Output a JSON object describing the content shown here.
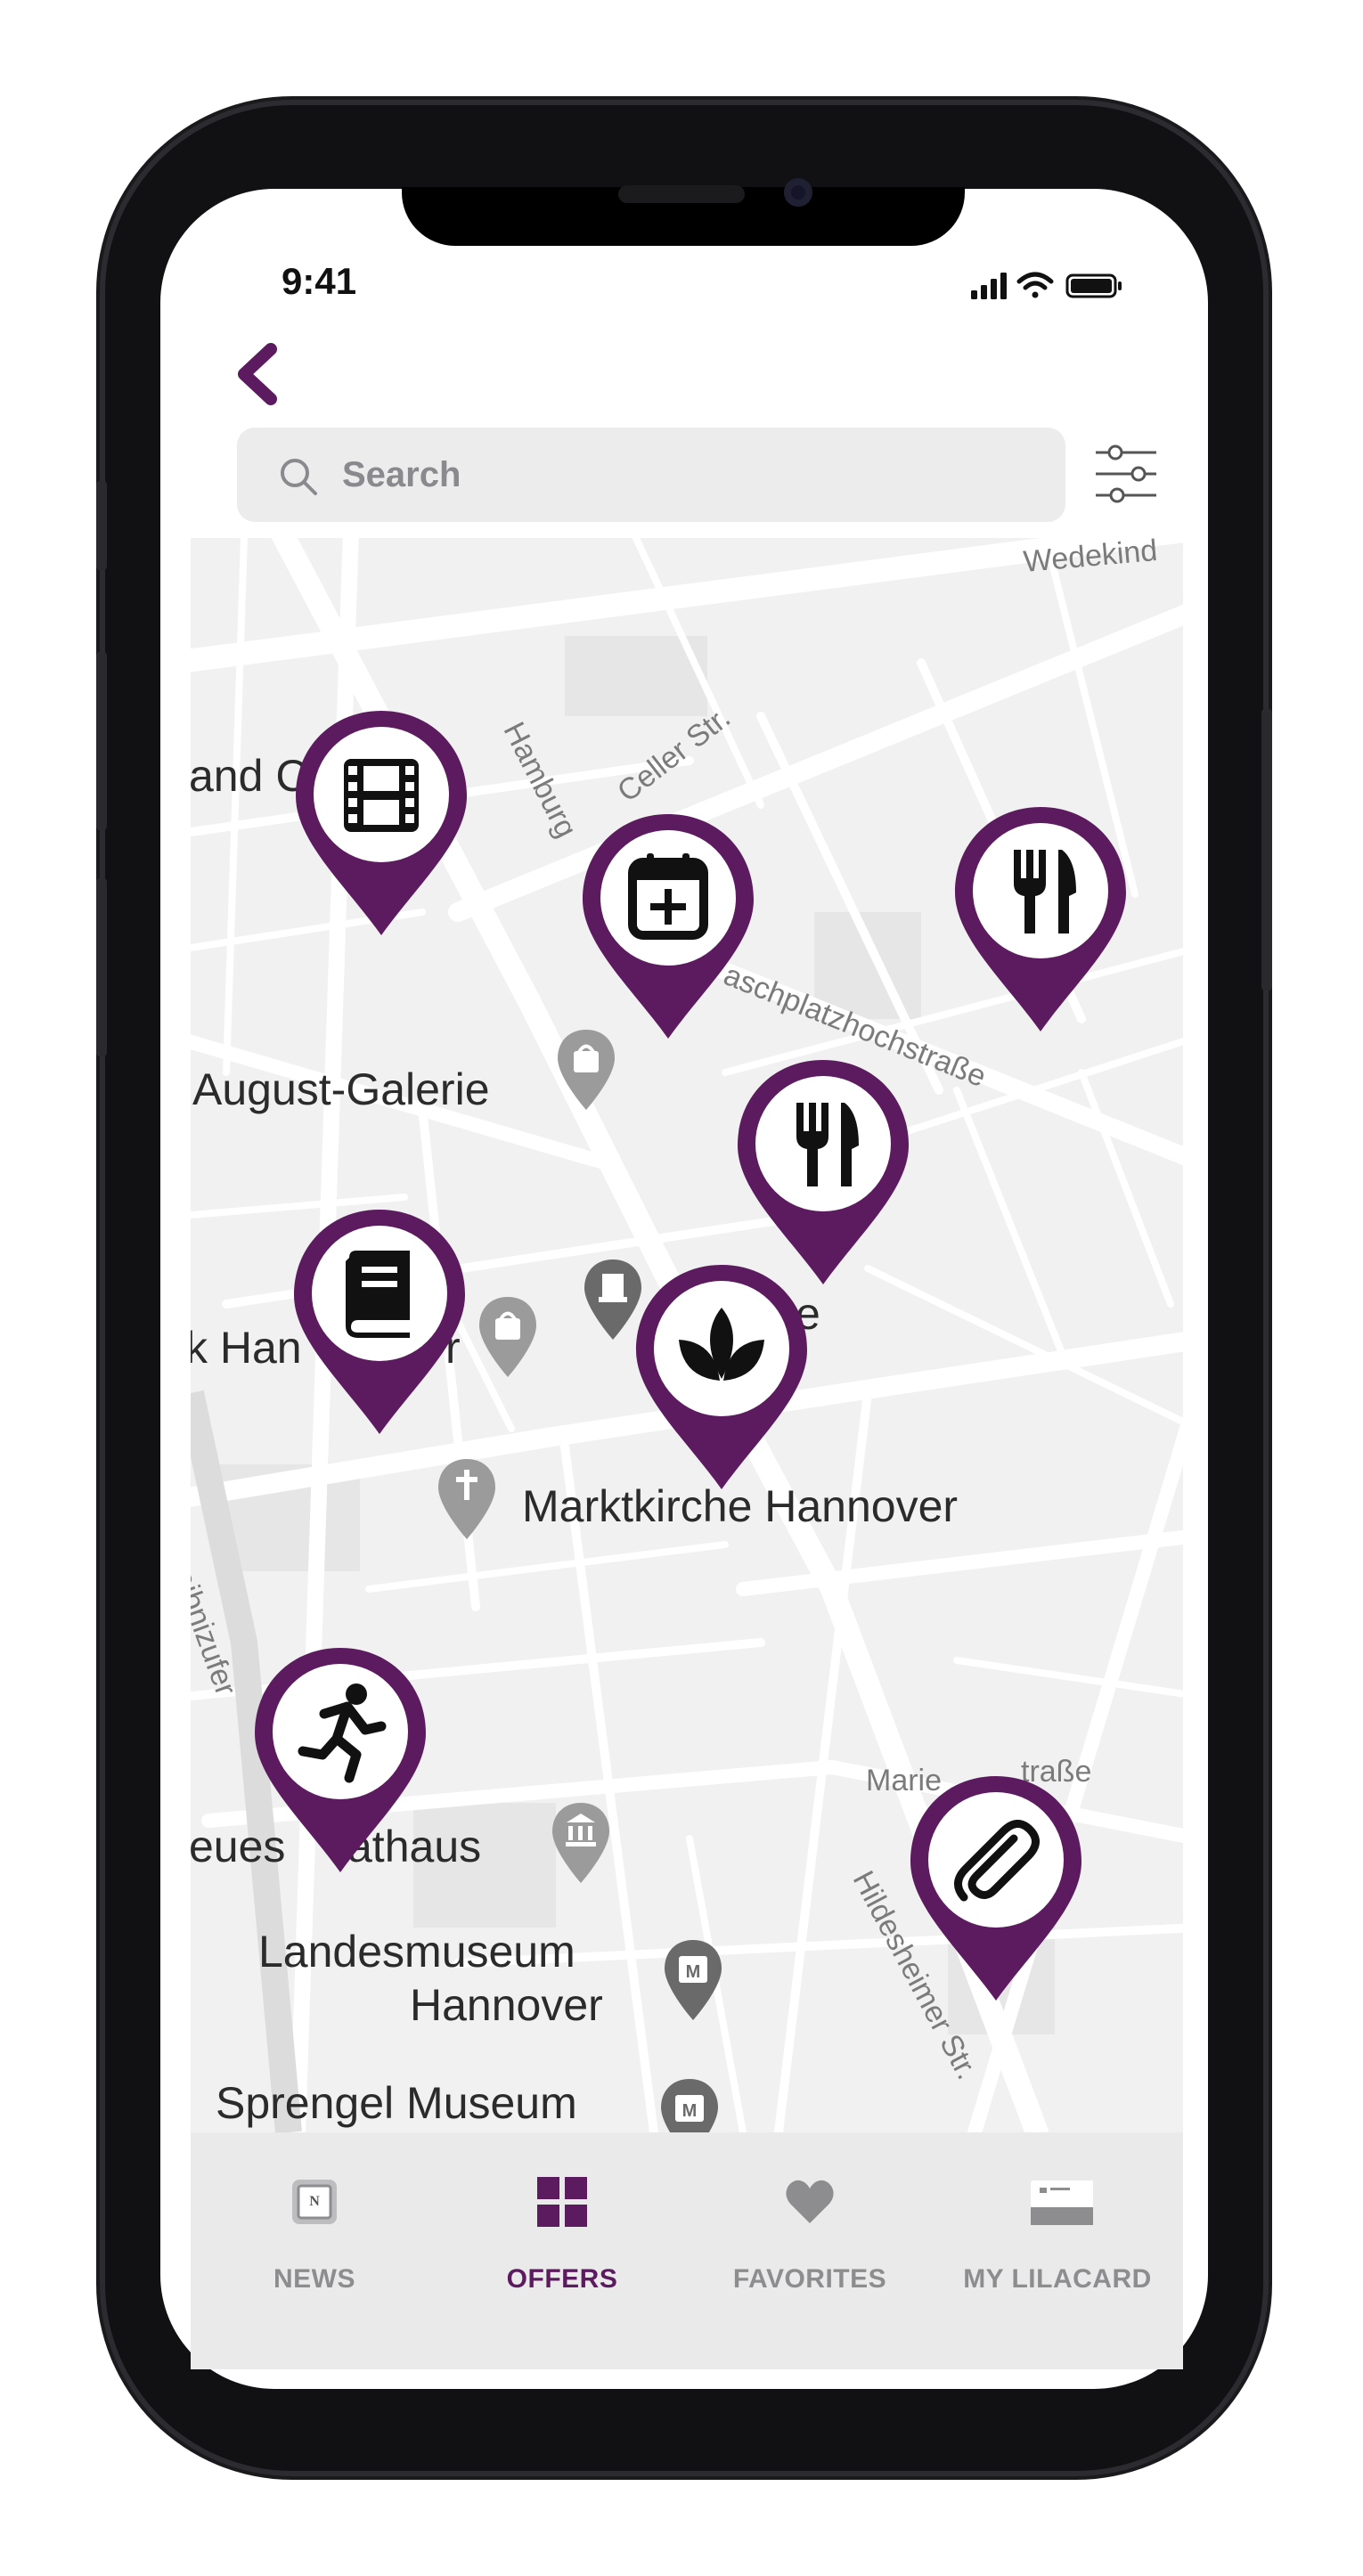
{
  "status_bar": {
    "time": "9:41"
  },
  "search": {
    "placeholder": "Search",
    "value": ""
  },
  "colors": {
    "accent": "#5c1b5f",
    "tab_inactive": "#8d8d90",
    "map_bg": "#f1f1f1"
  },
  "map": {
    "places": [
      "and C",
      "August-Galerie",
      "k Han",
      "r",
      "ke",
      "Marktkirche Hannover",
      "eues",
      "athaus",
      "Landesmuseum",
      "Hannover",
      "Sprengel Museum"
    ],
    "streets": [
      "Wedekind",
      "Hamburg",
      "Celler Str.",
      "aschplatzhochstraße",
      "eibnizufer",
      "Marie",
      "traße",
      "Hildesheimer Str."
    ],
    "pins": [
      {
        "icon": "film-icon"
      },
      {
        "icon": "calendar-add-icon"
      },
      {
        "icon": "fork-knife-icon"
      },
      {
        "icon": "fork-knife-icon"
      },
      {
        "icon": "book-icon"
      },
      {
        "icon": "lotus-icon"
      },
      {
        "icon": "running-person-icon"
      },
      {
        "icon": "paperclip-icon"
      }
    ]
  },
  "tabs": [
    {
      "label": "NEWS",
      "icon": "news-icon",
      "active": false
    },
    {
      "label": "OFFERS",
      "icon": "grid-icon",
      "active": true
    },
    {
      "label": "FAVORITES",
      "icon": "heart-icon",
      "active": false
    },
    {
      "label": "MY LILACARD",
      "icon": "card-icon",
      "active": false
    }
  ]
}
